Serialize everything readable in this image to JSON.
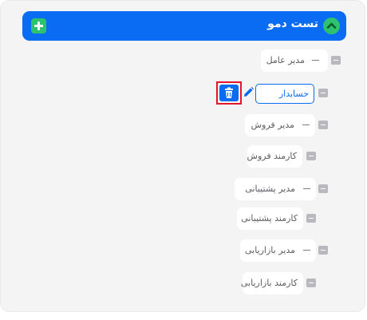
{
  "header": {
    "title": "تست دمو"
  },
  "selected_node": {
    "label": "حسابدار"
  },
  "nodes": [
    {
      "label": "مدیر عامل"
    },
    {
      "label": "مدیر فروش"
    },
    {
      "label": "کارمند فروش"
    },
    {
      "label": "مدیر پشتیبانی"
    },
    {
      "label": "کارمند پشتیبانی"
    },
    {
      "label": "مدیر بازاریابی"
    },
    {
      "label": "کارمند بازاریابی"
    }
  ],
  "colors": {
    "primary": "#0a6bf3",
    "success": "#2ec26f",
    "danger": "#e3172a",
    "panel_background": "#f4f4f5"
  }
}
